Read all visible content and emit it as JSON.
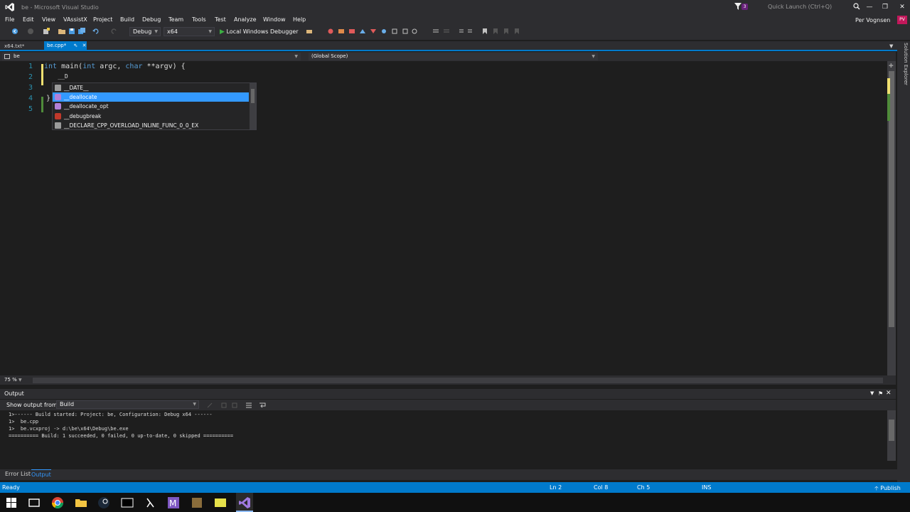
{
  "window": {
    "title": "be - Microsoft Visual Studio",
    "notification_count": "3",
    "quick_launch_placeholder": "Quick Launch (Ctrl+Q)",
    "buttons": [
      "minimize",
      "maximize",
      "close"
    ]
  },
  "menu": {
    "items": [
      "File",
      "Edit",
      "View",
      "VAssistX",
      "Project",
      "Build",
      "Debug",
      "Team",
      "Tools",
      "Test",
      "Analyze",
      "Window",
      "Help"
    ],
    "user_name": "Per Vognsen",
    "user_initials": "PV"
  },
  "toolbar": {
    "config": "Debug",
    "platform": "x64",
    "run_label": "Local Windows Debugger"
  },
  "doc_tabs": [
    {
      "label": "x64.txt*",
      "active": false
    },
    {
      "label": "be.cpp*",
      "active": true
    }
  ],
  "navbar": {
    "project": "be",
    "scope": "(Global Scope)"
  },
  "side_panel": {
    "label": "Solution Explorer"
  },
  "editor": {
    "line_numbers": [
      "1",
      "2",
      "3",
      "4",
      "5"
    ],
    "code": {
      "line1_kw1": "int",
      "line1_rest1": " main(",
      "line1_kw2": "int",
      "line1_rest2": " argc, ",
      "line1_kw3": "char",
      "line1_rest3": " **argv) {",
      "line2": "    __D",
      "line4": "}"
    },
    "zoom": "75 %"
  },
  "completion": {
    "items": [
      {
        "label": "__DATE__",
        "icon": "macro-icon",
        "color": "#9b9b9b"
      },
      {
        "label": "__deallocate",
        "icon": "function-icon",
        "color": "#b180d7",
        "selected": true
      },
      {
        "label": "__deallocate_opt",
        "icon": "function-icon",
        "color": "#b180d7"
      },
      {
        "label": "__debugbreak",
        "icon": "intrinsic-icon",
        "color": "#c0392b"
      },
      {
        "label": "__DECLARE_CPP_OVERLOAD_INLINE_FUNC_0_0_EX",
        "icon": "macro-icon",
        "color": "#9b9b9b"
      }
    ]
  },
  "output": {
    "title": "Output",
    "show_from_label": "Show output from:",
    "show_from_value": "Build",
    "lines": [
      "1>------ Build started: Project: be, Configuration: Debug x64 ------",
      "1>  be.cpp",
      "1>  be.vcxproj -> d:\\be\\x64\\Debug\\be.exe",
      "========== Build: 1 succeeded, 0 failed, 0 up-to-date, 0 skipped =========="
    ]
  },
  "bottom_tabs": [
    "Error List",
    "Output"
  ],
  "status": {
    "state": "Ready",
    "ln": "Ln 2",
    "col": "Col 8",
    "ch": "Ch 5",
    "mode": "INS",
    "publish": "Publish"
  },
  "taskbar": {
    "icons": [
      "windows-start-icon",
      "task-view-icon",
      "chrome-icon",
      "file-explorer-icon",
      "steam-icon",
      "terminal-icon",
      "git-icon",
      "emacs-icon",
      "app-icon",
      "folder-icon",
      "visual-studio-icon"
    ]
  },
  "colors": {
    "accent": "#007acc",
    "selection": "#3399ff",
    "keyword": "#569cd6",
    "line_number": "#2b91af"
  }
}
